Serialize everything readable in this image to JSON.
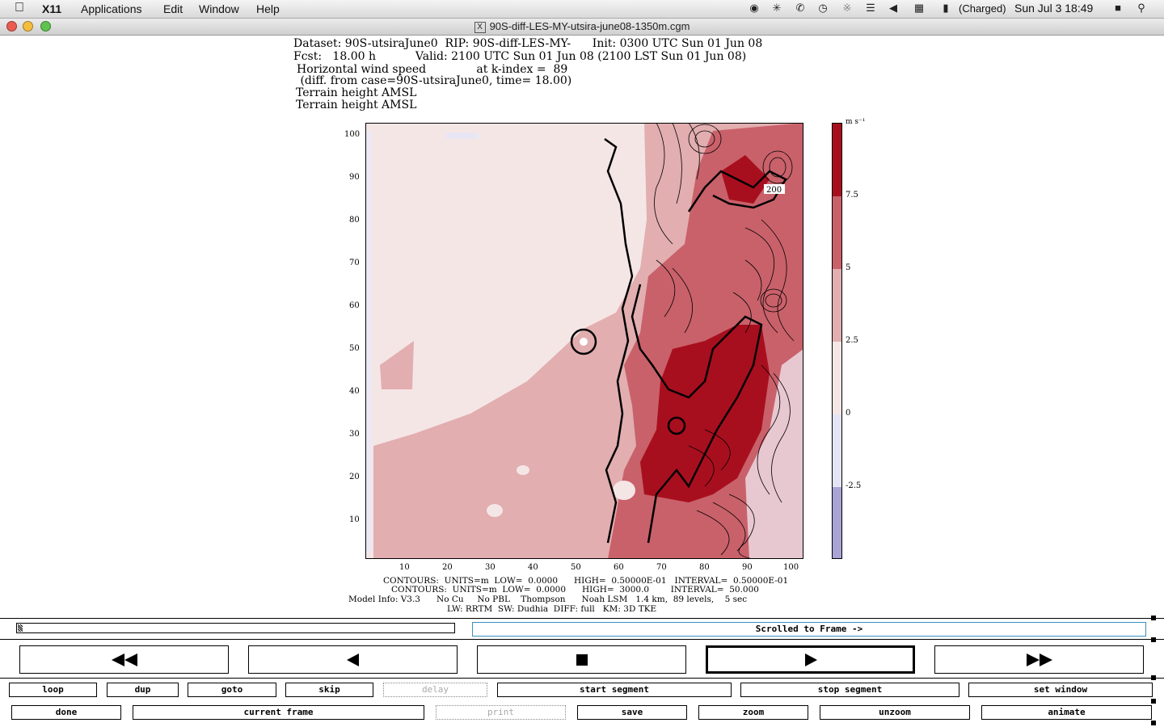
{
  "menubar": {
    "app": "X11",
    "items": [
      "Applications",
      "Edit",
      "Window",
      "Help"
    ],
    "battery": "(Charged)",
    "clock": "Sun Jul 3  18:49"
  },
  "window": {
    "title": "90S-diff-LES-MY-utsira-june08-1350m.cgm"
  },
  "plot": {
    "header": {
      "line1": "Dataset: 90S-utsiraJune0  RIP: 90S-diff-LES-MY-      Init: 0300 UTC Sun 01 Jun 08",
      "line2": "Fcst:   18.00 h           Valid: 2100 UTC Sun 01 Jun 08 (2100 LST Sun 01 Jun 08)",
      "line3": "Horizontal wind speed              at k-index =  89",
      "line4": " (diff. from case=90S-utsiraJune0, time= 18.00)",
      "line5": "Terrain height AMSL",
      "line6": "Terrain height AMSL"
    },
    "x_ticks": [
      "10",
      "20",
      "30",
      "40",
      "50",
      "60",
      "70",
      "80",
      "90",
      "100"
    ],
    "y_ticks": [
      "100",
      "90",
      "80",
      "70",
      "60",
      "50",
      "40",
      "30",
      "20",
      "10"
    ],
    "contour_label": "200",
    "colorbar": {
      "unit": "m s⁻¹",
      "labels": [
        "7.5",
        "5",
        "2.5",
        "0",
        "-2.5"
      ],
      "colors": [
        "#a80f1e",
        "#c9616a",
        "#e2aeb0",
        "#f5e6e6",
        "#e4e4f4",
        "#a9a3d6"
      ]
    },
    "footer": {
      "line1": "CONTOURS:  UNITS=m  LOW=  0.0000      HIGH=  0.50000E-01   INTERVAL=  0.50000E-01",
      "line2": "CONTOURS:  UNITS=m  LOW=  0.0000      HIGH=  3000.0        INTERVAL=  50.000",
      "line3": "Model Info: V3.3      No Cu     No PBL    Thompson      Noah LSM   1.4 km,  89 levels,    5 sec",
      "line4": "LW: RRTM  SW: Dudhia  DIFF: full   KM: 3D TKE"
    }
  },
  "controls": {
    "status": "Scrolled to Frame ->",
    "row1": [
      "loop",
      "dup",
      "goto",
      "skip",
      "delay",
      "start segment",
      "stop segment",
      "set window"
    ],
    "row2": [
      "done",
      "current frame",
      "print",
      "save",
      "zoom",
      "unzoom",
      "animate"
    ]
  }
}
